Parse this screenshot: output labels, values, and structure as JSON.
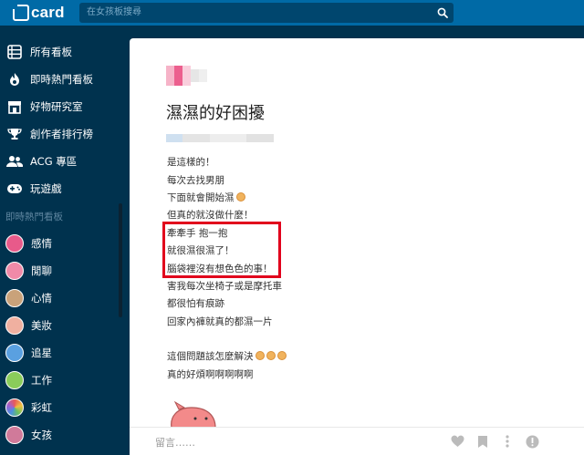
{
  "brand": {
    "logo_text": "card"
  },
  "search": {
    "placeholder": "在女孩板搜尋",
    "icon": "search-icon"
  },
  "sidebar": {
    "nav": [
      {
        "label": "所有看板",
        "icon": "list-icon"
      },
      {
        "label": "即時熱門看板",
        "icon": "flame-icon"
      },
      {
        "label": "好物研究室",
        "icon": "store-icon"
      },
      {
        "label": "創作者排行榜",
        "icon": "trophy-icon"
      },
      {
        "label": "ACG 專區",
        "icon": "users-icon"
      },
      {
        "label": "玩遊戲",
        "icon": "gamepad-icon"
      }
    ],
    "section_title": "即時熱門看板",
    "boards": [
      {
        "label": "感情",
        "color": "#e85a8a"
      },
      {
        "label": "閒聊",
        "color": "#f08aa8"
      },
      {
        "label": "心情",
        "color": "#c9a27a"
      },
      {
        "label": "美妝",
        "color": "#f0b0a0"
      },
      {
        "label": "追星",
        "color": "#5aa0e0"
      },
      {
        "label": "工作",
        "color": "#8acc5a"
      },
      {
        "label": "彩虹",
        "color": "#e85a5a"
      },
      {
        "label": "女孩",
        "color": "#d07a9a"
      }
    ]
  },
  "post": {
    "title": "濕濕的好困擾",
    "lines": [
      "是這樣的！",
      "每次去找男朋",
      "下面就會開始濕",
      "但真的就沒做什麼！",
      "牽牽手 抱一抱",
      "就很濕很濕了！",
      "腦袋裡沒有想色色的事！",
      "害我每次坐椅子或是摩托車",
      "都很怕有痕跡",
      "回家內褲就真的都濕一片",
      "",
      "這個問題該怎麼解決",
      "真的好煩啊啊啊啊啊"
    ]
  },
  "footer": {
    "comment_placeholder": "留言……",
    "actions": [
      "heart-icon",
      "bookmark-icon",
      "more-icon",
      "info-icon"
    ]
  },
  "colors": {
    "topbar": "#006aa6",
    "sidebar": "#00324e",
    "highlight": "#e1001c"
  }
}
